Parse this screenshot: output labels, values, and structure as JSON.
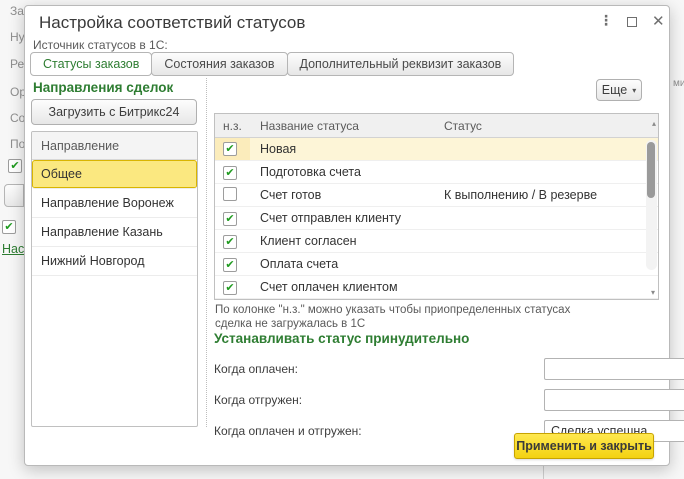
{
  "background": {
    "left_fragments": [
      "За",
      "Ну",
      "Ре",
      "Ор",
      "Со",
      "По"
    ],
    "right_fragment": "ми",
    "link_text": "Нас"
  },
  "icons": {
    "kebab": "⋮",
    "close": "✕",
    "check": "✔",
    "dropdown": "▾",
    "scroll_up": "▴",
    "scroll_down": "▾"
  },
  "colors": {
    "accent_green": "#2e7d32",
    "selection_yellow": "#fbe880",
    "selection_border": "#d9b501",
    "row_highlight": "#fdf5d7",
    "apply_button_yellow": "#f3d211"
  },
  "dialog": {
    "title": "Настройка соответствий статусов",
    "source_label": "Источник статусов в 1С:",
    "tabs": [
      {
        "label": "Статусы заказов",
        "active": true
      },
      {
        "label": "Состояния заказов",
        "active": false
      },
      {
        "label": "Дополнительный реквизит заказов",
        "active": false
      }
    ],
    "left_panel": {
      "header": "Направления сделок",
      "load_button": "Загрузить с Битрикс24",
      "list_header": "Направление",
      "items": [
        "Общее",
        "Направление Воронеж",
        "Направление Казань",
        "Нижний Новгород"
      ],
      "selected_item": "Общее"
    },
    "more_button": "Еще",
    "table": {
      "columns": [
        "н.з.",
        "Название статуса",
        "Статус"
      ],
      "rows": [
        {
          "checked": true,
          "name": "Новая",
          "status": "",
          "highlighted": true
        },
        {
          "checked": true,
          "name": "Подготовка счета",
          "status": "",
          "highlighted": false
        },
        {
          "checked": false,
          "name": "Счет готов",
          "status": "К выполнению / В резерве",
          "highlighted": false
        },
        {
          "checked": true,
          "name": "Счет отправлен клиенту",
          "status": "",
          "highlighted": false
        },
        {
          "checked": true,
          "name": "Клиент согласен",
          "status": "",
          "highlighted": false
        },
        {
          "checked": true,
          "name": "Оплата счета",
          "status": "",
          "highlighted": false
        },
        {
          "checked": true,
          "name": "Счет оплачен клиентом",
          "status": "",
          "highlighted": false
        }
      ]
    },
    "note_line1": "По колонке \"н.з.\" можно указать чтобы приопределенных статусах",
    "note_line2": "сделка не загружалась в 1С",
    "force_header": "Устанавливать статус принудительно",
    "force_fields": [
      {
        "label": "Когда оплачен:",
        "value": ""
      },
      {
        "label": "Когда отгружен:",
        "value": ""
      },
      {
        "label": "Когда оплачен и отгружен:",
        "value": "Сделка успешна"
      }
    ],
    "apply_button": "Применить и закрыть"
  }
}
